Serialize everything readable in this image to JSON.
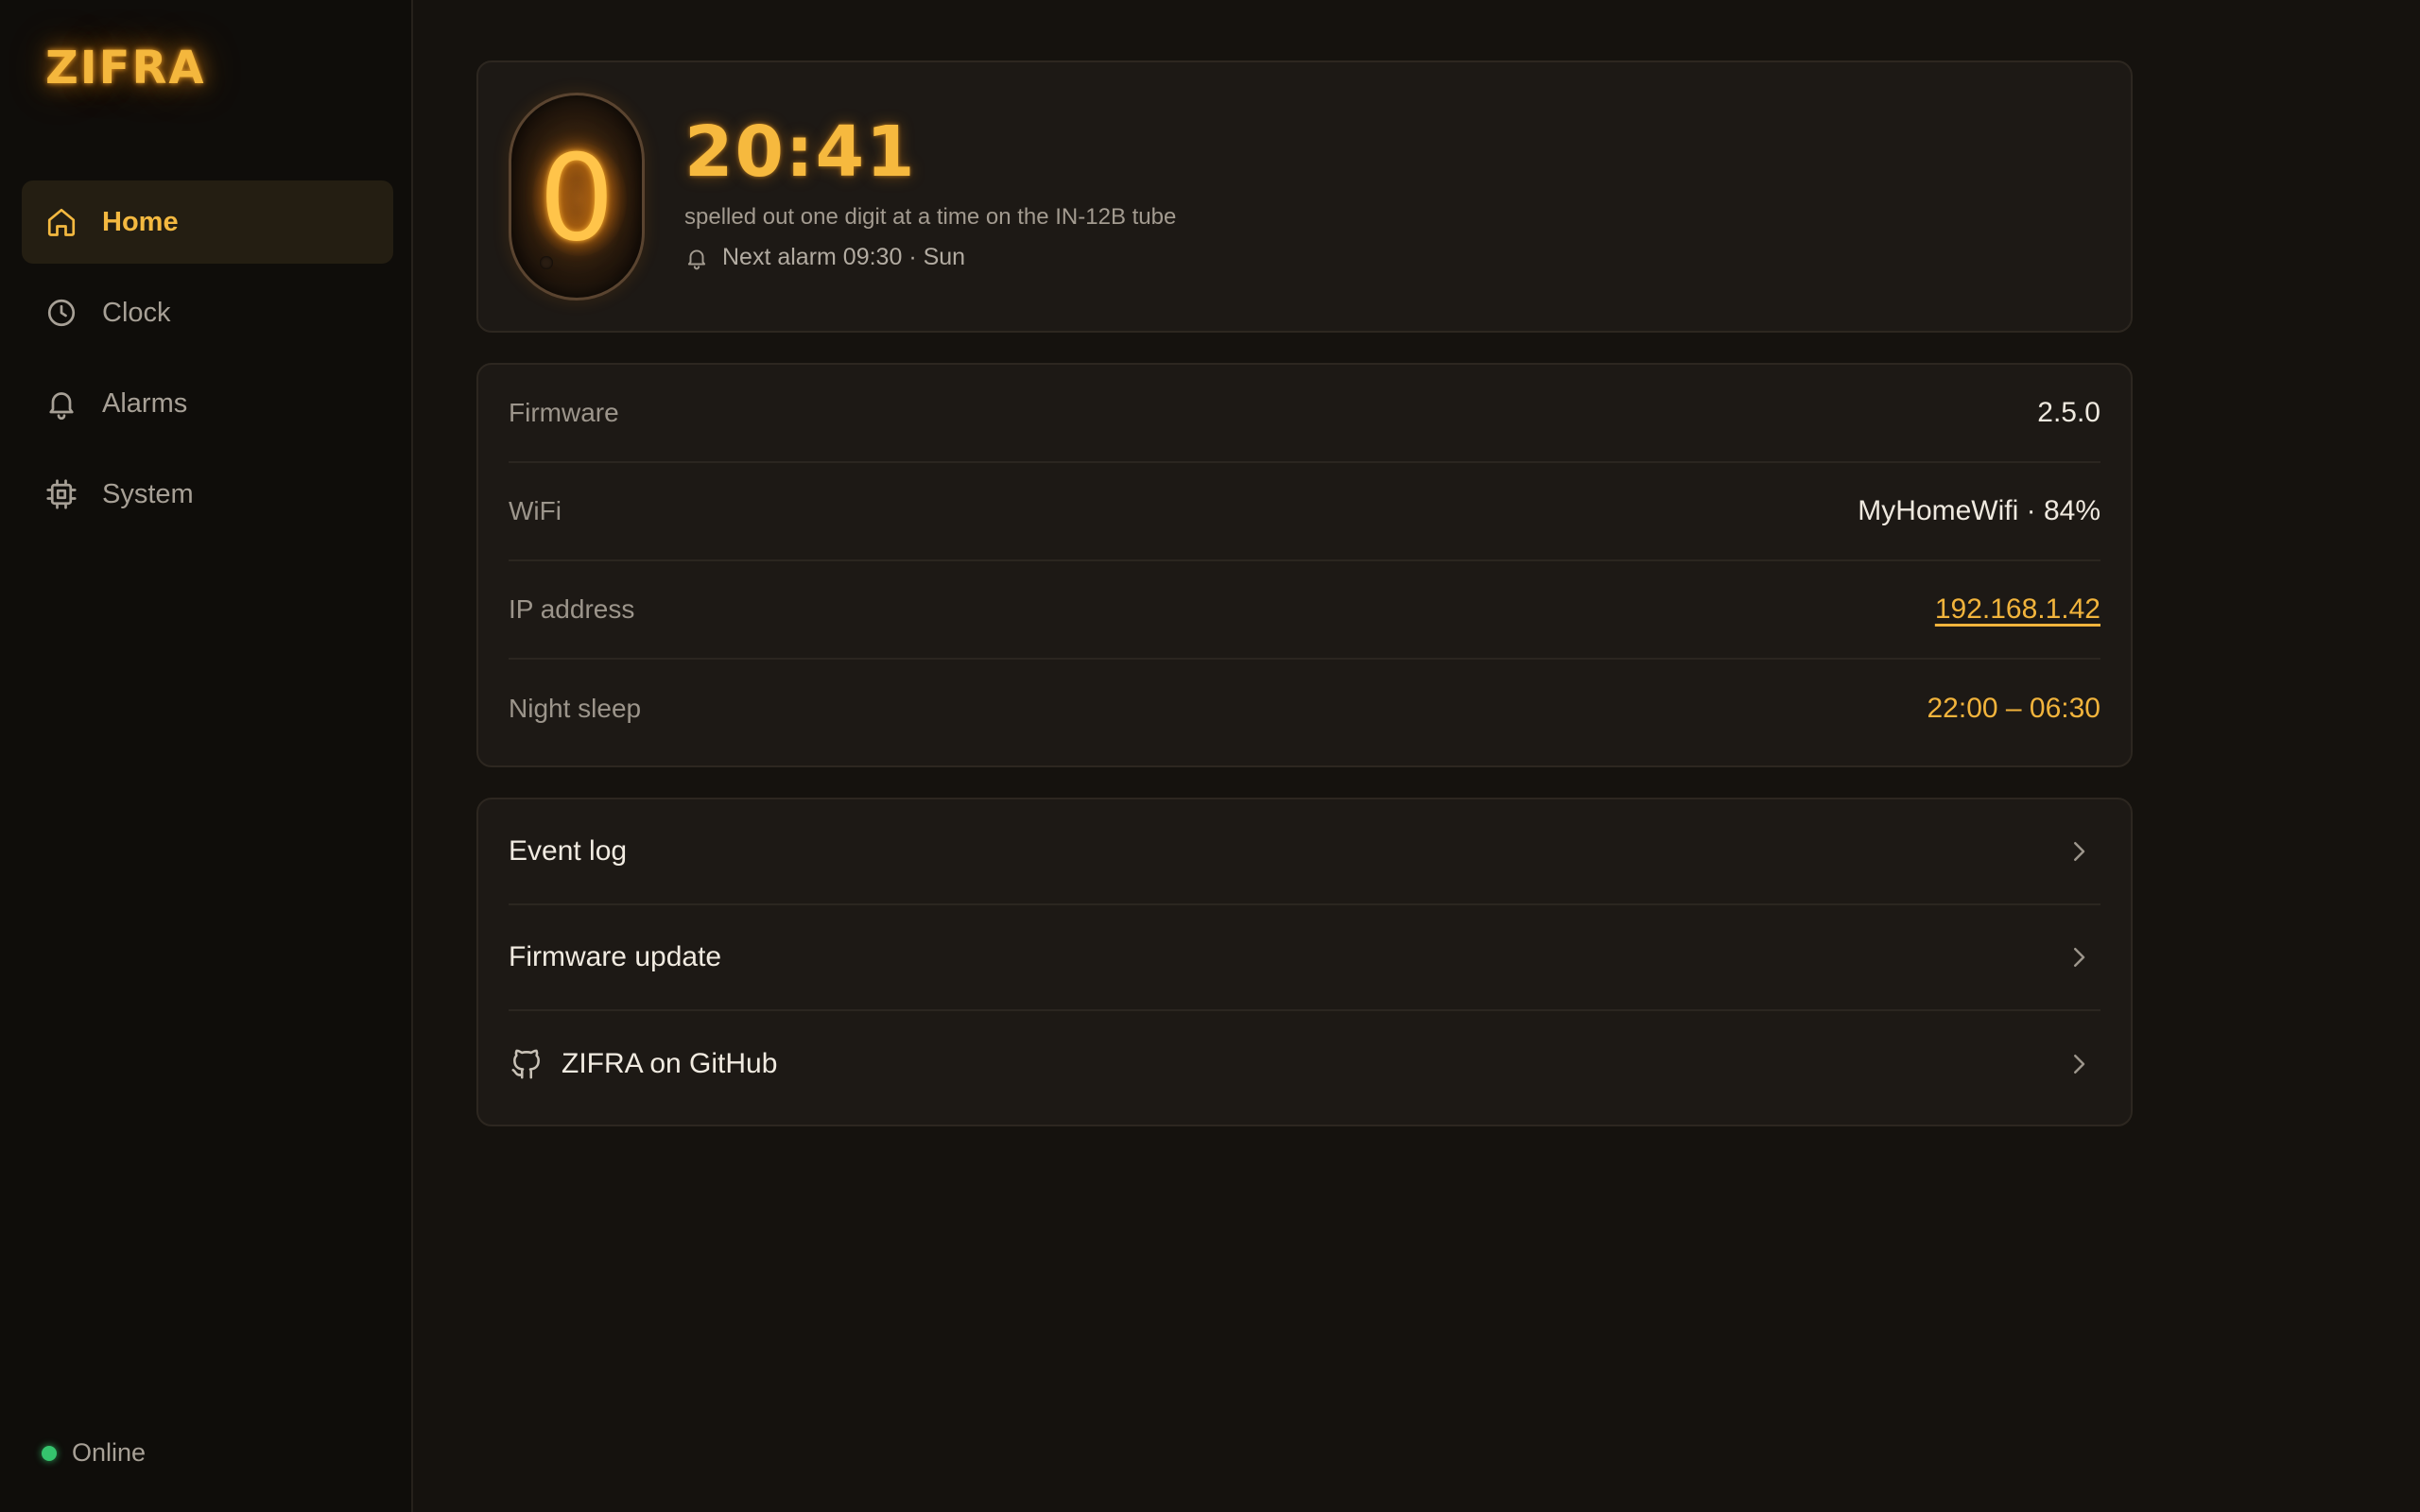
{
  "app": {
    "logo": "ZIFRA"
  },
  "sidebar": {
    "items": [
      {
        "label": "Home",
        "icon": "home-icon",
        "active": true
      },
      {
        "label": "Clock",
        "icon": "clock-icon",
        "active": false
      },
      {
        "label": "Alarms",
        "icon": "bell-icon",
        "active": false
      },
      {
        "label": "System",
        "icon": "chip-icon",
        "active": false
      }
    ],
    "status": {
      "label": "Online",
      "color": "#35c46d"
    }
  },
  "hero": {
    "tube_digit": "0",
    "time": "20:41",
    "subtitle": "spelled out one digit at a time on the IN-12B tube",
    "next_alarm": "Next alarm 09:30 · Sun"
  },
  "info": {
    "firmware": {
      "label": "Firmware",
      "value": "2.5.0"
    },
    "wifi": {
      "label": "WiFi",
      "value": "MyHomeWifi · 84%"
    },
    "ip": {
      "label": "IP address",
      "value": "192.168.1.42"
    },
    "night_sleep": {
      "label": "Night sleep",
      "value": "22:00 – 06:30"
    }
  },
  "links": {
    "event_log": "Event log",
    "firmware_update": "Firmware update",
    "github": "ZIFRA on GitHub"
  },
  "colors": {
    "accent": "#f4b73d",
    "background": "#15120e",
    "sidebar": "#0f0d0a",
    "card": "#1d1915",
    "online": "#35c46d"
  }
}
